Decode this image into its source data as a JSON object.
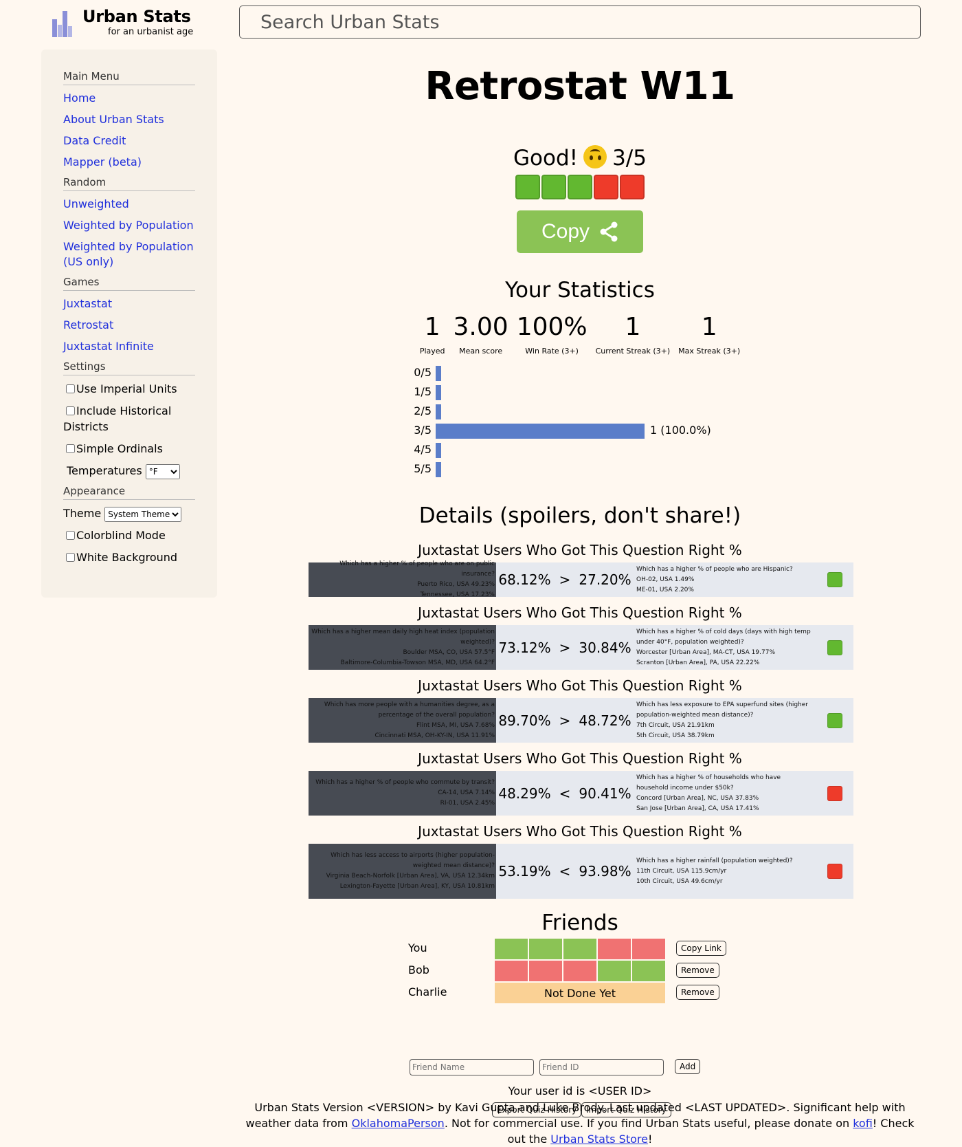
{
  "header": {
    "logo_title": "Urban Stats",
    "logo_subtitle": "for an urbanist age",
    "search_placeholder": "Search Urban Stats"
  },
  "sidebar": {
    "main_menu": "Main Menu",
    "home": "Home",
    "about": "About Urban Stats",
    "data_credit": "Data Credit",
    "mapper": "Mapper (beta)",
    "random": "Random",
    "unweighted": "Unweighted",
    "weighted_pop": "Weighted by Population",
    "weighted_pop_us": "Weighted by Population (US only)",
    "games": "Games",
    "juxtastat": "Juxtastat",
    "retrostat": "Retrostat",
    "juxtastat_infinite": "Juxtastat Infinite",
    "settings": "Settings",
    "imperial": "Use Imperial Units",
    "historical": "Include Historical Districts",
    "simple_ordinals": "Simple Ordinals",
    "temperatures": "Temperatures",
    "temp_unit": "°F",
    "appearance": "Appearance",
    "theme": "Theme",
    "theme_value": "System Theme",
    "colorblind": "Colorblind Mode",
    "white_bg": "White Background"
  },
  "quiz": {
    "title": "Retrostat W11",
    "result_word": "Good!",
    "score": "3/5",
    "results": [
      "correct",
      "correct",
      "correct",
      "wrong",
      "wrong"
    ],
    "copy_label": "Copy"
  },
  "statistics": {
    "title": "Your Statistics",
    "items": [
      {
        "value": "1",
        "label": "Played"
      },
      {
        "value": "3.00",
        "label": "Mean score"
      },
      {
        "value": "100%",
        "label": "Win Rate (3+)"
      },
      {
        "value": "1",
        "label": "Current Streak (3+)"
      },
      {
        "value": "1",
        "label": "Max Streak (3+)"
      }
    ]
  },
  "histogram": {
    "rows": [
      {
        "label": "0/5",
        "fraction": 0,
        "text": ""
      },
      {
        "label": "1/5",
        "fraction": 0,
        "text": ""
      },
      {
        "label": "2/5",
        "fraction": 0,
        "text": ""
      },
      {
        "label": "3/5",
        "fraction": 1,
        "text": "1 (100.0%)"
      },
      {
        "label": "4/5",
        "fraction": 0,
        "text": ""
      },
      {
        "label": "5/5",
        "fraction": 0,
        "text": ""
      }
    ]
  },
  "details": {
    "title": "Details (spoilers, don't share!)",
    "questions": [
      {
        "header": "Juxtastat Users Who Got This Question Right %",
        "left_q": "Which has a higher % of people who are on public insurance?",
        "left_a": "Puerto Rico, USA 49.23%",
        "left_b": "Tennessee, USA 17.23%",
        "left_pct": "68.12%",
        "op": ">",
        "right_pct": "27.20%",
        "right_q": "Which has a higher % of people who are Hispanic?",
        "right_a": "OH-02, USA 1.49%",
        "right_b": "ME-01, USA 2.20%",
        "result": "correct"
      },
      {
        "header": "Juxtastat Users Who Got This Question Right %",
        "left_q": "Which has a higher mean daily high heat index (population weighted)?",
        "left_a": "Boulder MSA, CO, USA 57.5°F",
        "left_b": "Baltimore-Columbia-Towson MSA, MD, USA 64.2°F",
        "left_pct": "73.12%",
        "op": ">",
        "right_pct": "30.84%",
        "right_q": "Which has a higher % of cold days (days with high temp under 40°F, population weighted)?",
        "right_a": "Worcester [Urban Area], MA-CT, USA 19.77%",
        "right_b": "Scranton [Urban Area], PA, USA 22.22%",
        "result": "correct"
      },
      {
        "header": "Juxtastat Users Who Got This Question Right %",
        "left_q": "Which has more people with a humanities degree, as a percentage of the overall population?",
        "left_a": "Flint MSA, MI, USA 7.68%",
        "left_b": "Cincinnati MSA, OH-KY-IN, USA 11.91%",
        "left_pct": "89.70%",
        "op": ">",
        "right_pct": "48.72%",
        "right_q": "Which has less exposure to EPA superfund sites (higher population-weighted mean distance)?",
        "right_a": "7th Circuit, USA 21.91km",
        "right_b": "5th Circuit, USA 38.79km",
        "result": "correct"
      },
      {
        "header": "Juxtastat Users Who Got This Question Right %",
        "left_q": "Which has a higher % of people who commute by transit?",
        "left_a": "CA-14, USA 7.14%",
        "left_b": "RI-01, USA 2.45%",
        "left_pct": "48.29%",
        "op": "<",
        "right_pct": "90.41%",
        "right_q": "Which has a higher % of households who have household income under $50k?",
        "right_a": "Concord [Urban Area], NC, USA 37.83%",
        "right_b": "San Jose [Urban Area], CA, USA 17.41%",
        "result": "wrong"
      },
      {
        "header": "Juxtastat Users Who Got This Question Right %",
        "left_q": "Which has less access to airports (higher population-weighted mean distance)?",
        "left_a": "Virginia Beach-Norfolk [Urban Area], VA, USA 12.34km",
        "left_b": "Lexington-Fayette [Urban Area], KY, USA 10.81km",
        "left_pct": "53.19%",
        "op": "<",
        "right_pct": "93.98%",
        "right_q": "Which has a higher rainfall (population weighted)?",
        "right_a": "11th Circuit, USA 115.9cm/yr",
        "right_b": "10th Circuit, USA 49.6cm/yr",
        "result": "wrong"
      }
    ]
  },
  "friends": {
    "title": "Friends",
    "rows": [
      {
        "name": "You",
        "results": [
          "correct",
          "correct",
          "correct",
          "wrong",
          "wrong"
        ],
        "button": "Copy Link"
      },
      {
        "name": "Bob",
        "results": [
          "wrong",
          "wrong",
          "wrong",
          "correct",
          "correct"
        ],
        "button": "Remove"
      },
      {
        "name": "Charlie",
        "status": "Not Done Yet",
        "button": "Remove"
      }
    ],
    "friend_name_placeholder": "Friend Name",
    "friend_id_placeholder": "Friend ID",
    "add_label": "Add",
    "user_id_text": "Your user id is <USER ID>",
    "export_label": "Export Quiz History",
    "import_label": "Import Quiz History"
  },
  "footer": {
    "part1": "Urban Stats Version <VERSION> by Kavi Gupta and Luke Brody. Last updated <LAST UPDATED>. Significant help with weather data from ",
    "link1": "OklahomaPerson",
    "part2": ". Not for commercial use. If you find Urban Stats useful, please donate on ",
    "link2": "kofi",
    "part3": "! Check out the ",
    "link3": "Urban Stats Store",
    "part4": "!"
  },
  "colors": {
    "background": "#fff8f0",
    "link": "#1f2fdc",
    "correct": "#8bc355",
    "wrong": "#f07272",
    "bar": "#5a7dc9"
  }
}
